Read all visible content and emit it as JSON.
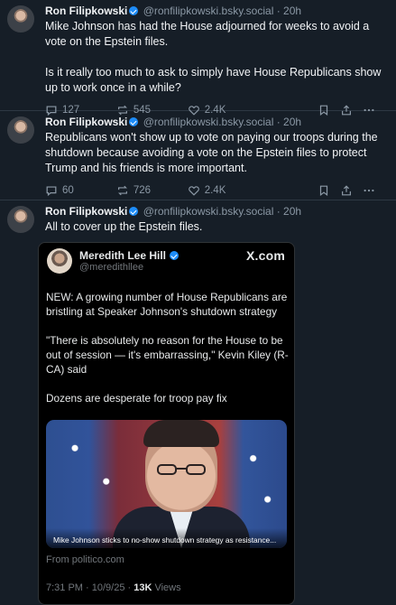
{
  "posts": [
    {
      "name": "Ron Filipkowski",
      "handle": "@ronfilipkowski.bsky.social",
      "sep": "·",
      "time": "20h",
      "text": "Mike Johnson has had the House adjourned for weeks to avoid a vote on the Epstein files.\n\nIs it really too much to ask to simply have House Republicans show up to work once in a while?",
      "replies": "127",
      "reposts": "545",
      "likes": "2.4K"
    },
    {
      "name": "Ron Filipkowski",
      "handle": "@ronfilipkowski.bsky.social",
      "sep": "·",
      "time": "20h",
      "text": "Republicans won't show up to vote on paying our troops during the shutdown because avoiding a vote on the Epstein files to protect Trump and his friends is more important.",
      "replies": "60",
      "reposts": "726",
      "likes": "2.4K"
    },
    {
      "name": "Ron Filipkowski",
      "handle": "@ronfilipkowski.bsky.social",
      "sep": "·",
      "time": "20h",
      "text": "All to cover up the Epstein files."
    }
  ],
  "embed": {
    "name": "Meredith Lee Hill",
    "handle": "@meredithllee",
    "logo": "X.com",
    "text": "NEW: A growing number of House Republicans are bristling at Speaker Johnson's shutdown strategy\n\n\"There is absolutely no reason for the House to be out of session — it's embarrassing,\" Kevin Kiley (R-CA) said\n\nDozens are desperate for troop pay fix",
    "caption": "Mike Johnson sticks to no-show shutdown strategy as resistance...",
    "from": "From politico.com",
    "datetime": "7:31 PM · 10/9/25 · ",
    "views_count": "13K",
    "views_label": " Views"
  },
  "icons": [
    "reply-icon",
    "repost-icon",
    "like-icon",
    "bookmark-icon",
    "share-icon",
    "more-icon",
    "verified-icon"
  ],
  "colors": {
    "background": "#161e27",
    "verified": "#1d8cf8",
    "muted": "#8b98a5"
  }
}
